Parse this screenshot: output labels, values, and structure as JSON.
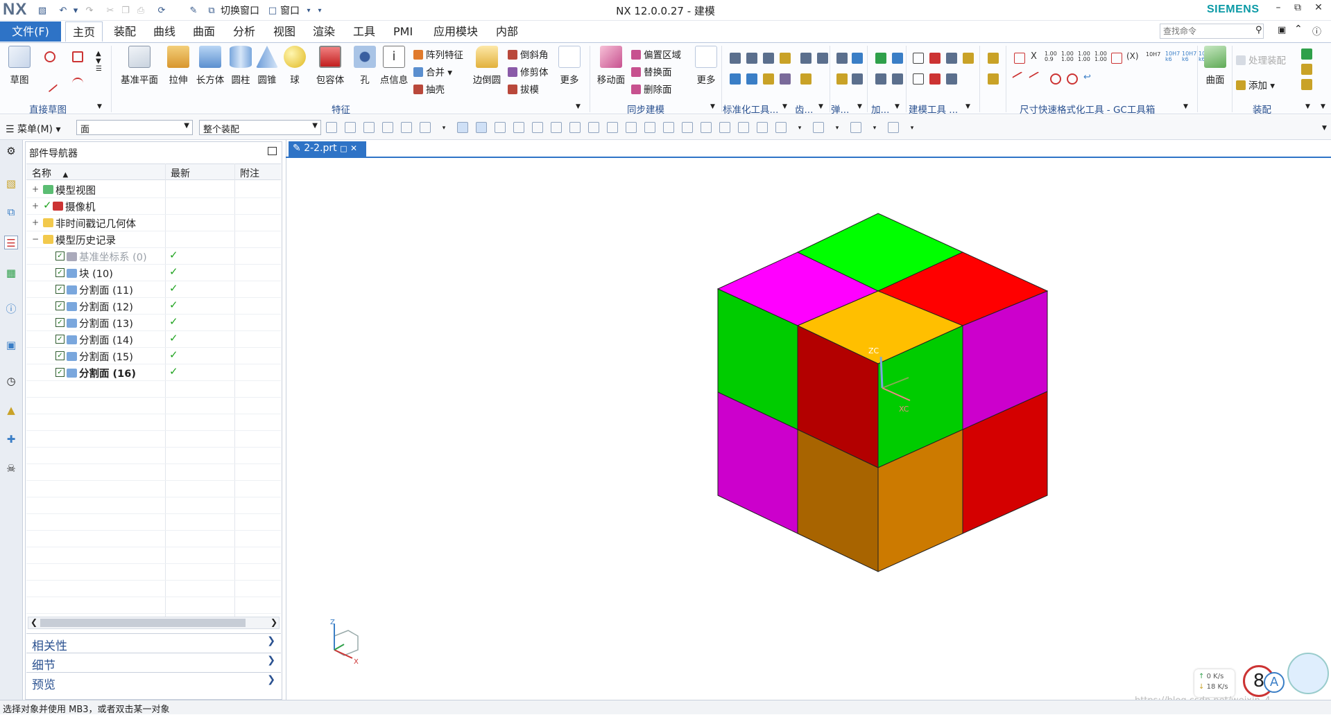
{
  "app": {
    "logo": "NX",
    "title": "NX 12.0.0.27 - 建模",
    "brand": "SIEMENS",
    "switch_window": "切换窗口",
    "window_menu": "窗口"
  },
  "menu_tabs": [
    "文件(F)",
    "主页",
    "装配",
    "曲线",
    "曲面",
    "分析",
    "视图",
    "渲染",
    "工具",
    "PMI",
    "应用模块",
    "内部"
  ],
  "search": {
    "placeholder": "查找命令"
  },
  "ribbon": {
    "sketch": {
      "label": "草图",
      "group": "直接草图"
    },
    "feature": {
      "group": "特征",
      "datum_plane": "基准平面",
      "extrude": "拉伸",
      "block": "长方体",
      "cylinder": "圆柱",
      "cone": "圆锥",
      "sphere": "球",
      "bounding_body": "包容体",
      "hole": "孔",
      "point_info": "点信息",
      "pattern_feature": "阵列特征",
      "unite": "合并",
      "shell": "抽壳",
      "edge_blend": "边倒圆",
      "chamfer": "倒斜角",
      "trim_body": "修剪体",
      "draft": "拔模",
      "more": "更多"
    },
    "sync": {
      "group": "同步建模",
      "move_face": "移动面",
      "offset_region": "偏置区域",
      "replace_face": "替换面",
      "delete_face": "删除面",
      "more": "更多"
    },
    "groups": {
      "standardization": "标准化工具...",
      "gear": "齿...",
      "spring": "弹...",
      "add": "加...",
      "modeling_tools": "建模工具 ...",
      "dim_tools": "尺寸快速格式化工具 - GC工具箱",
      "assembly": "装配"
    },
    "surface": {
      "label": "曲面"
    },
    "assembly": {
      "process": "处理装配",
      "add": "添加"
    }
  },
  "select_bar": {
    "menu": "菜单(M)",
    "filter": "面",
    "scope": "整个装配"
  },
  "navigator": {
    "title": "部件导航器",
    "columns": [
      "名称",
      "最新",
      "附注"
    ],
    "nodes": [
      {
        "label": "模型视图"
      },
      {
        "label": "摄像机"
      },
      {
        "label": "非时间戳记几何体"
      },
      {
        "label": "模型历史记录"
      }
    ],
    "features": [
      {
        "label": "基准坐标系 (0)",
        "dim": true
      },
      {
        "label": "块 (10)"
      },
      {
        "label": "分割面 (11)"
      },
      {
        "label": "分割面 (12)"
      },
      {
        "label": "分割面 (13)"
      },
      {
        "label": "分割面 (14)"
      },
      {
        "label": "分割面 (15)"
      },
      {
        "label": "分割面 (16)",
        "bold": true
      }
    ],
    "panels": [
      "相关性",
      "细节",
      "预览"
    ]
  },
  "doc_tab": {
    "name": "2-2.prt"
  },
  "viewport": {
    "csys": {
      "z": "ZC",
      "x": "XC"
    },
    "triad": {
      "z": "Z",
      "x": "X"
    },
    "cube_colors": {
      "green": "#00ff00",
      "red": "#ff0000",
      "magenta": "#ff00ff",
      "yellow": "#ffbf00",
      "dark_red": "#b30000",
      "dark_green": "#00cc00",
      "dark_magenta": "#cc00cc",
      "orange": "#cc7a00",
      "dark_orange": "#a86400",
      "deep_red": "#d40000"
    },
    "net": {
      "up": "0",
      "down": "18",
      "unit": "K/s"
    },
    "badge": "8",
    "watermark": "https://blog.csdn.net/weixin_4..."
  },
  "status": {
    "text": "选择对象并使用 MB3，或者双击某一对象"
  }
}
